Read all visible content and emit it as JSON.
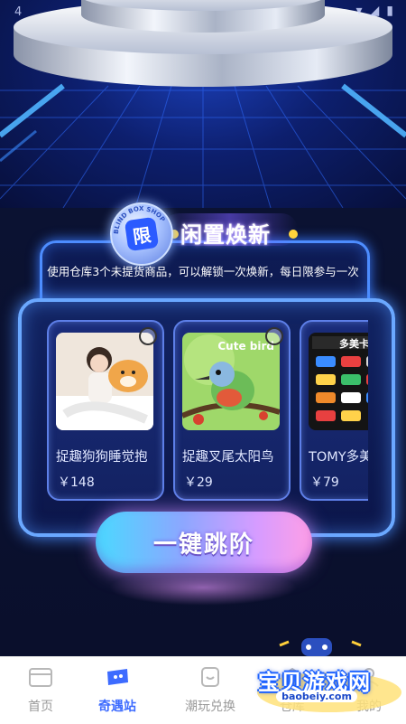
{
  "status_bar": {
    "time": "4"
  },
  "badge": {
    "char": "限",
    "ring_text": "BLIND BOX SHOP"
  },
  "header": {
    "title": "闲置焕新",
    "subtitle": "使用仓库3个未提货商品，可以解锁一次焕新，每日限参与一次"
  },
  "products": [
    {
      "name": "捉趣狗狗睡觉抱",
      "price": "￥148",
      "image": "girl-with-plush-dog"
    },
    {
      "name": "捉趣叉尾太阳鸟",
      "price": "￥29",
      "image": "bird-plush",
      "image_text": "Cute bird"
    },
    {
      "name": "TOMY多美",
      "price": "￥79",
      "image": "toy-cars-box",
      "image_text": "多美卡黑"
    }
  ],
  "cta": {
    "label": "一键跳阶"
  },
  "tabs": [
    {
      "label": "首页",
      "icon": "box-icon",
      "active": false
    },
    {
      "label": "奇遇站",
      "icon": "ticket-icon",
      "active": true
    },
    {
      "label": "潮玩兑换",
      "icon": "exchange-icon",
      "active": false
    },
    {
      "label": "仓库",
      "icon": "warehouse-icon",
      "active": false
    },
    {
      "label": "我的",
      "icon": "user-icon",
      "active": false
    }
  ],
  "watermark": {
    "text": "宝贝游戏网",
    "url": "baobeiy.com"
  },
  "colors": {
    "accent": "#3d6bff",
    "glow": "#4d8dff",
    "cta_start": "#4ad9ff",
    "cta_end": "#ff9fe6"
  }
}
